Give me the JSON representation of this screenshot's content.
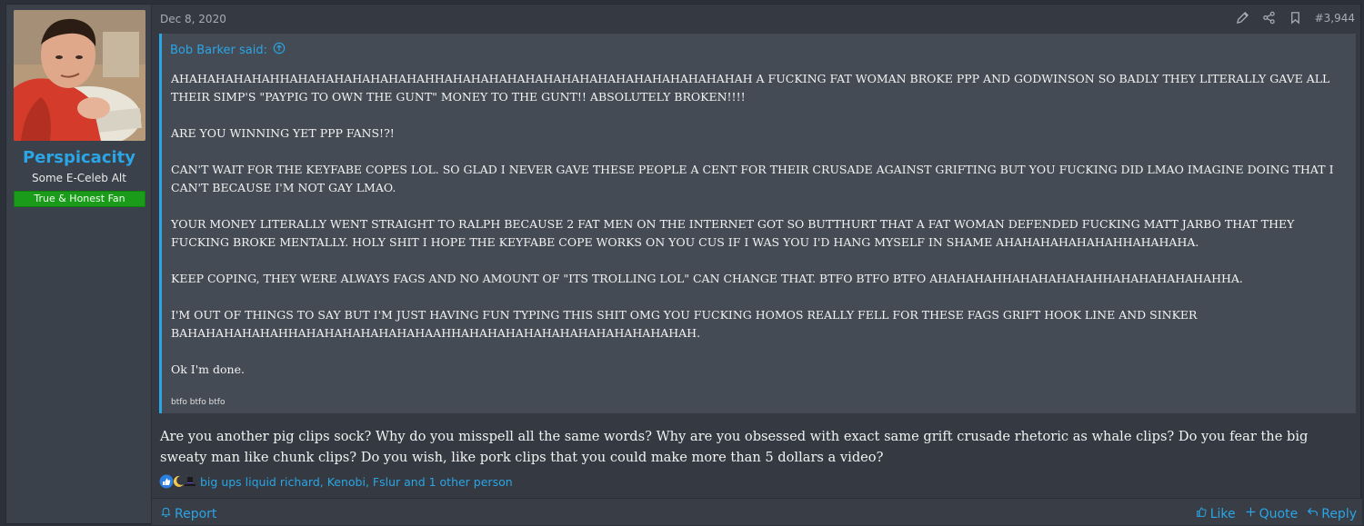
{
  "user": {
    "name": "Perspicacity",
    "title": "Some E-Celeb Alt",
    "banner": "True & Honest Fan"
  },
  "post": {
    "date": "Dec 8, 2020",
    "number": "#3,944"
  },
  "quote": {
    "author_label": "Bob Barker said:",
    "paragraphs": [
      "AHAHAHAHAHAHHAHAHAHAHAHAHAHAHHAHAHAHAHAHAHAHAHAHAHAHAHAHAHAHAHAH A FUCKING FAT WOMAN BROKE PPP AND GODWINSON SO BADLY THEY LITERALLY GAVE ALL THEIR SIMP'S \"PAYPIG TO OWN THE GUNT\" MONEY TO THE GUNT!! ABSOLUTELY BROKEN!!!!",
      "ARE YOU WINNING YET PPP FANS!?!",
      "CAN'T WAIT FOR THE KEYFABE COPES LOL. SO GLAD I NEVER GAVE THESE PEOPLE A CENT FOR THEIR CRUSADE AGAINST GRIFTING BUT YOU FUCKING DID LMAO IMAGINE DOING THAT I CAN'T BECAUSE I'M NOT GAY LMAO.",
      "YOUR MONEY LITERALLY WENT STRAIGHT TO RALPH BECAUSE 2 FAT MEN ON THE INTERNET GOT SO BUTTHURT THAT A FAT WOMAN DEFENDED FUCKING MATT JARBO THAT THEY FUCKING BROKE MENTALLY. HOLY SHIT I HOPE THE KEYFABE COPE WORKS ON YOU CUS IF I WAS YOU I'D HANG MYSELF IN SHAME AHAHAHAHAHAHAHHAHAHAHA.",
      "KEEP COPING, THEY WERE ALWAYS FAGS AND NO AMOUNT OF \"ITS TROLLING LOL\" CAN CHANGE THAT. BTFO BTFO BTFO AHAHAHAHHAHAHAHAHAHHAHAHAHAHAHAHHA.",
      "I'M OUT OF THINGS TO SAY BUT I'M JUST HAVING FUN TYPING THIS SHIT OMG YOU FUCKING HOMOS REALLY FELL FOR THESE FAGS GRIFT HOOK LINE AND SINKER BAHAHAHAHAHAHHAHAHAHAHAHAHAHAAHHAHAHAHAHAHAHAHAHAHAHAHAHAH.",
      "Ok I'm done."
    ],
    "small": "btfo btfo btfo"
  },
  "message": "Are you another pig clips sock? Why do you misspell all the same words? Why are you obsessed with exact same grift crusade rhetoric as whale clips? Do you fear the big sweaty man like chunk clips? Do you wish, like pork clips that you could make more than 5 dollars a video?",
  "reactions": {
    "text": "big ups liquid richard, Kenobi, Fslur and 1 other person",
    "icons": [
      "like-icon",
      "crescent-moon-icon",
      "top-hat-icon"
    ]
  },
  "footer": {
    "report": "Report",
    "like": "Like",
    "quote": "Quote",
    "reply": "Reply"
  },
  "colors": {
    "accent": "#2aa5e6",
    "banner": "#1a9b1a",
    "background": "#353a42"
  }
}
